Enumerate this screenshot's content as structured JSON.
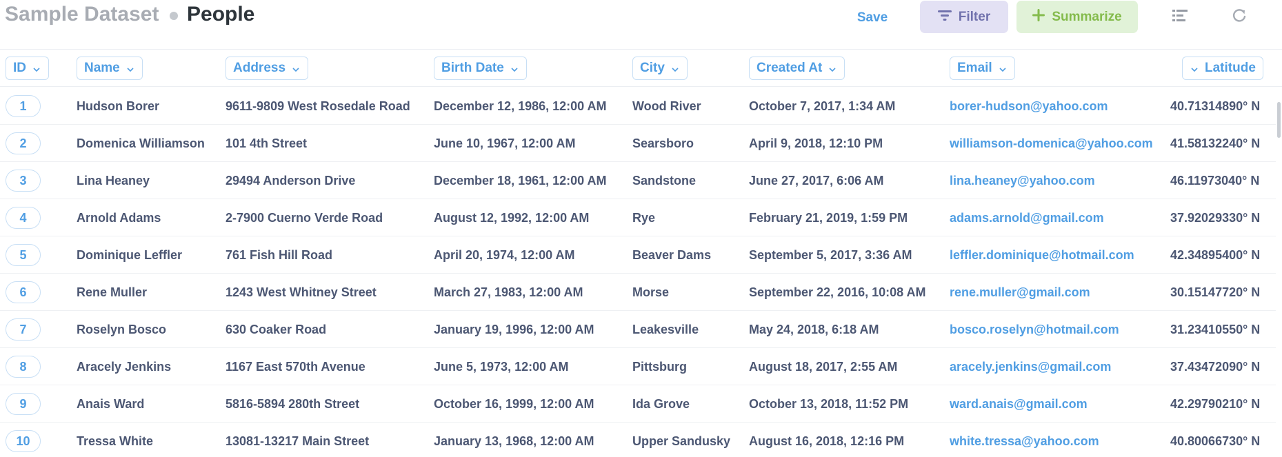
{
  "header": {
    "collection": "Sample Dataset",
    "title": "People",
    "save_label": "Save",
    "filter_label": "Filter",
    "summarize_label": "Summarize",
    "icons": [
      "filter-icon",
      "plus-icon",
      "columns-icon",
      "refresh-icon"
    ]
  },
  "columns": [
    "ID",
    "Name",
    "Address",
    "Birth Date",
    "City",
    "Created At",
    "Email",
    "Latitude"
  ],
  "rows": [
    {
      "id": "1",
      "name": "Hudson Borer",
      "address": "9611-9809 West Rosedale Road",
      "birth_date": "December 12, 1986, 12:00 AM",
      "city": "Wood River",
      "created_at": "October 7, 2017, 1:34 AM",
      "email": "borer-hudson@yahoo.com",
      "latitude": "40.71314890° N"
    },
    {
      "id": "2",
      "name": "Domenica Williamson",
      "address": "101 4th Street",
      "birth_date": "June 10, 1967, 12:00 AM",
      "city": "Searsboro",
      "created_at": "April 9, 2018, 12:10 PM",
      "email": "williamson-domenica@yahoo.com",
      "latitude": "41.58132240° N"
    },
    {
      "id": "3",
      "name": "Lina Heaney",
      "address": "29494 Anderson Drive",
      "birth_date": "December 18, 1961, 12:00 AM",
      "city": "Sandstone",
      "created_at": "June 27, 2017, 6:06 AM",
      "email": "lina.heaney@yahoo.com",
      "latitude": "46.11973040° N"
    },
    {
      "id": "4",
      "name": "Arnold Adams",
      "address": "2-7900 Cuerno Verde Road",
      "birth_date": "August 12, 1992, 12:00 AM",
      "city": "Rye",
      "created_at": "February 21, 2019, 1:59 PM",
      "email": "adams.arnold@gmail.com",
      "latitude": "37.92029330° N"
    },
    {
      "id": "5",
      "name": "Dominique Leffler",
      "address": "761 Fish Hill Road",
      "birth_date": "April 20, 1974, 12:00 AM",
      "city": "Beaver Dams",
      "created_at": "September 5, 2017, 3:36 AM",
      "email": "leffler.dominique@hotmail.com",
      "latitude": "42.34895400° N"
    },
    {
      "id": "6",
      "name": "Rene Muller",
      "address": "1243 West Whitney Street",
      "birth_date": "March 27, 1983, 12:00 AM",
      "city": "Morse",
      "created_at": "September 22, 2016, 10:08 AM",
      "email": "rene.muller@gmail.com",
      "latitude": "30.15147720° N"
    },
    {
      "id": "7",
      "name": "Roselyn Bosco",
      "address": "630 Coaker Road",
      "birth_date": "January 19, 1996, 12:00 AM",
      "city": "Leakesville",
      "created_at": "May 24, 2018, 6:18 AM",
      "email": "bosco.roselyn@hotmail.com",
      "latitude": "31.23410550° N"
    },
    {
      "id": "8",
      "name": "Aracely Jenkins",
      "address": "1167 East 570th Avenue",
      "birth_date": "June 5, 1973, 12:00 AM",
      "city": "Pittsburg",
      "created_at": "August 18, 2017, 2:55 AM",
      "email": "aracely.jenkins@gmail.com",
      "latitude": "37.43472090° N"
    },
    {
      "id": "9",
      "name": "Anais Ward",
      "address": "5816-5894 280th Street",
      "birth_date": "October 16, 1999, 12:00 AM",
      "city": "Ida Grove",
      "created_at": "October 13, 2018, 11:52 PM",
      "email": "ward.anais@gmail.com",
      "latitude": "42.29790210° N"
    },
    {
      "id": "10",
      "name": "Tressa White",
      "address": "13081-13217 Main Street",
      "birth_date": "January 13, 1968, 12:00 AM",
      "city": "Upper Sandusky",
      "created_at": "August 16, 2018, 12:16 PM",
      "email": "white.tressa@yahoo.com",
      "latitude": "40.80066730° N"
    }
  ],
  "colors": {
    "brand": "#509ee3",
    "filter_bg": "#e3e1f4",
    "filter_fg": "#7172ad",
    "summarize_bg": "#e1f2d8",
    "summarize_fg": "#84bb4c",
    "text": "#4c5773"
  }
}
